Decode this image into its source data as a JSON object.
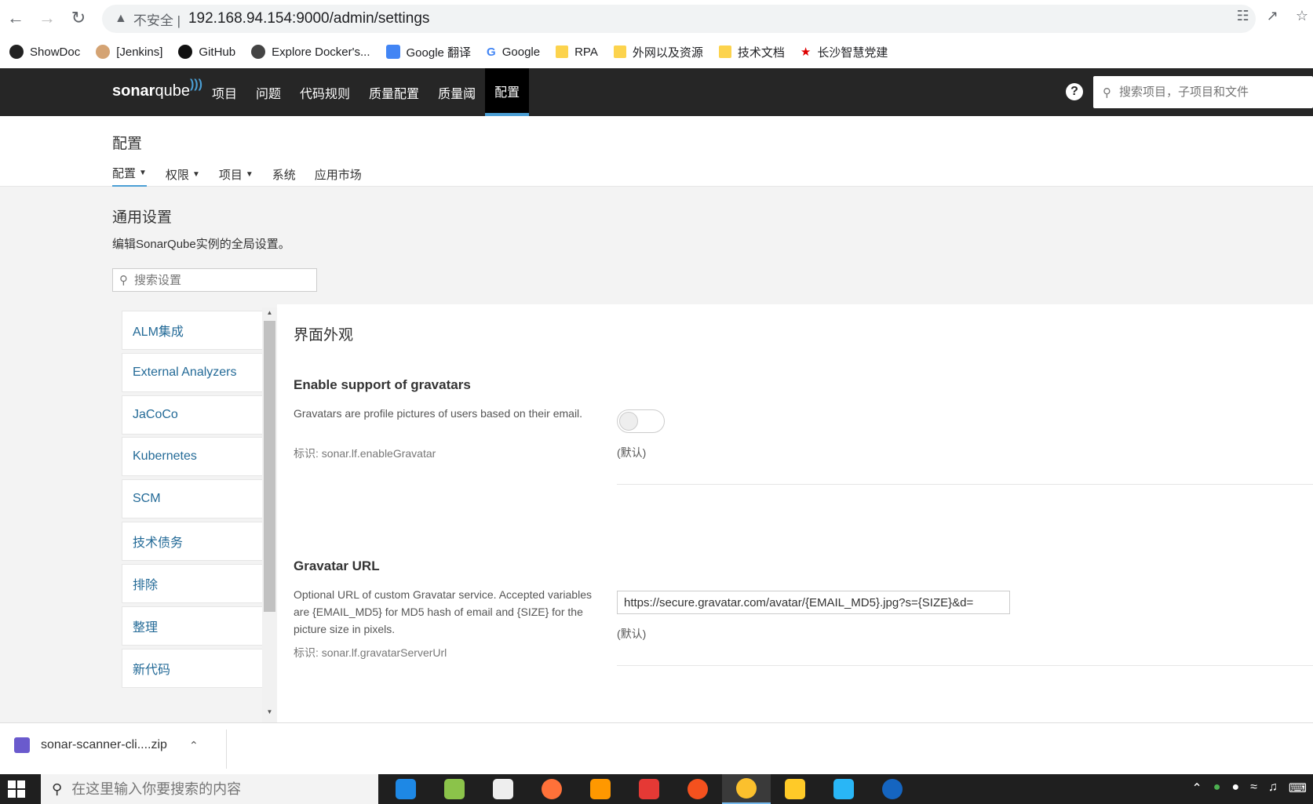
{
  "browser": {
    "insecure_label": "不安全 |",
    "url": "192.168.94.154:9000/admin/settings",
    "bookmarks": [
      "ShowDoc",
      "[Jenkins]",
      "GitHub",
      "Explore Docker's...",
      "Google 翻译",
      "Google",
      "RPA",
      "外网以及资源",
      "技术文档",
      "长沙智慧党建"
    ]
  },
  "nav": {
    "logo_sonar": "sonar",
    "logo_qube": "qube",
    "items": [
      "项目",
      "问题",
      "代码规则",
      "质量配置",
      "质量阈",
      "配置"
    ],
    "active_index": 5,
    "help": "?",
    "search_placeholder": "搜索项目，子项目和文件"
  },
  "page": {
    "title": "配置",
    "tabs": [
      "配置",
      "权限",
      "项目",
      "系统",
      "应用市场"
    ],
    "active_tab": 0
  },
  "section": {
    "title": "通用设置",
    "desc": "编辑SonarQube实例的全局设置。",
    "search_placeholder": "搜索设置"
  },
  "categories": [
    "ALM集成",
    "External Analyzers",
    "JaCoCo",
    "Kubernetes",
    "SCM",
    "技术债务",
    "排除",
    "整理",
    "新代码"
  ],
  "panel": {
    "title": "界面外观",
    "settings": [
      {
        "name": "Enable support of gravatars",
        "desc": "Gravatars are profile pictures of users based on their email.",
        "key": "标识: sonar.lf.enableGravatar",
        "default": "(默认)",
        "enabled": false
      },
      {
        "name": "Gravatar URL",
        "desc": "Optional URL of custom Gravatar service. Accepted variables are {EMAIL_MD5} for MD5 hash of email and {SIZE} for the picture size in pixels.",
        "key": "标识: sonar.lf.gravatarServerUrl",
        "value": "https://secure.gravatar.com/avatar/{EMAIL_MD5}.jpg?s={SIZE}&d=",
        "default": "(默认)"
      }
    ]
  },
  "download": {
    "filename": "sonar-scanner-cli....zip"
  },
  "taskbar": {
    "search_placeholder": "在这里输入你要搜索的内容"
  },
  "colors": {
    "nav_bg": "#262626",
    "accent": "#4b9fd5",
    "link": "#236a97",
    "content_bg": "#f3f3f3"
  }
}
